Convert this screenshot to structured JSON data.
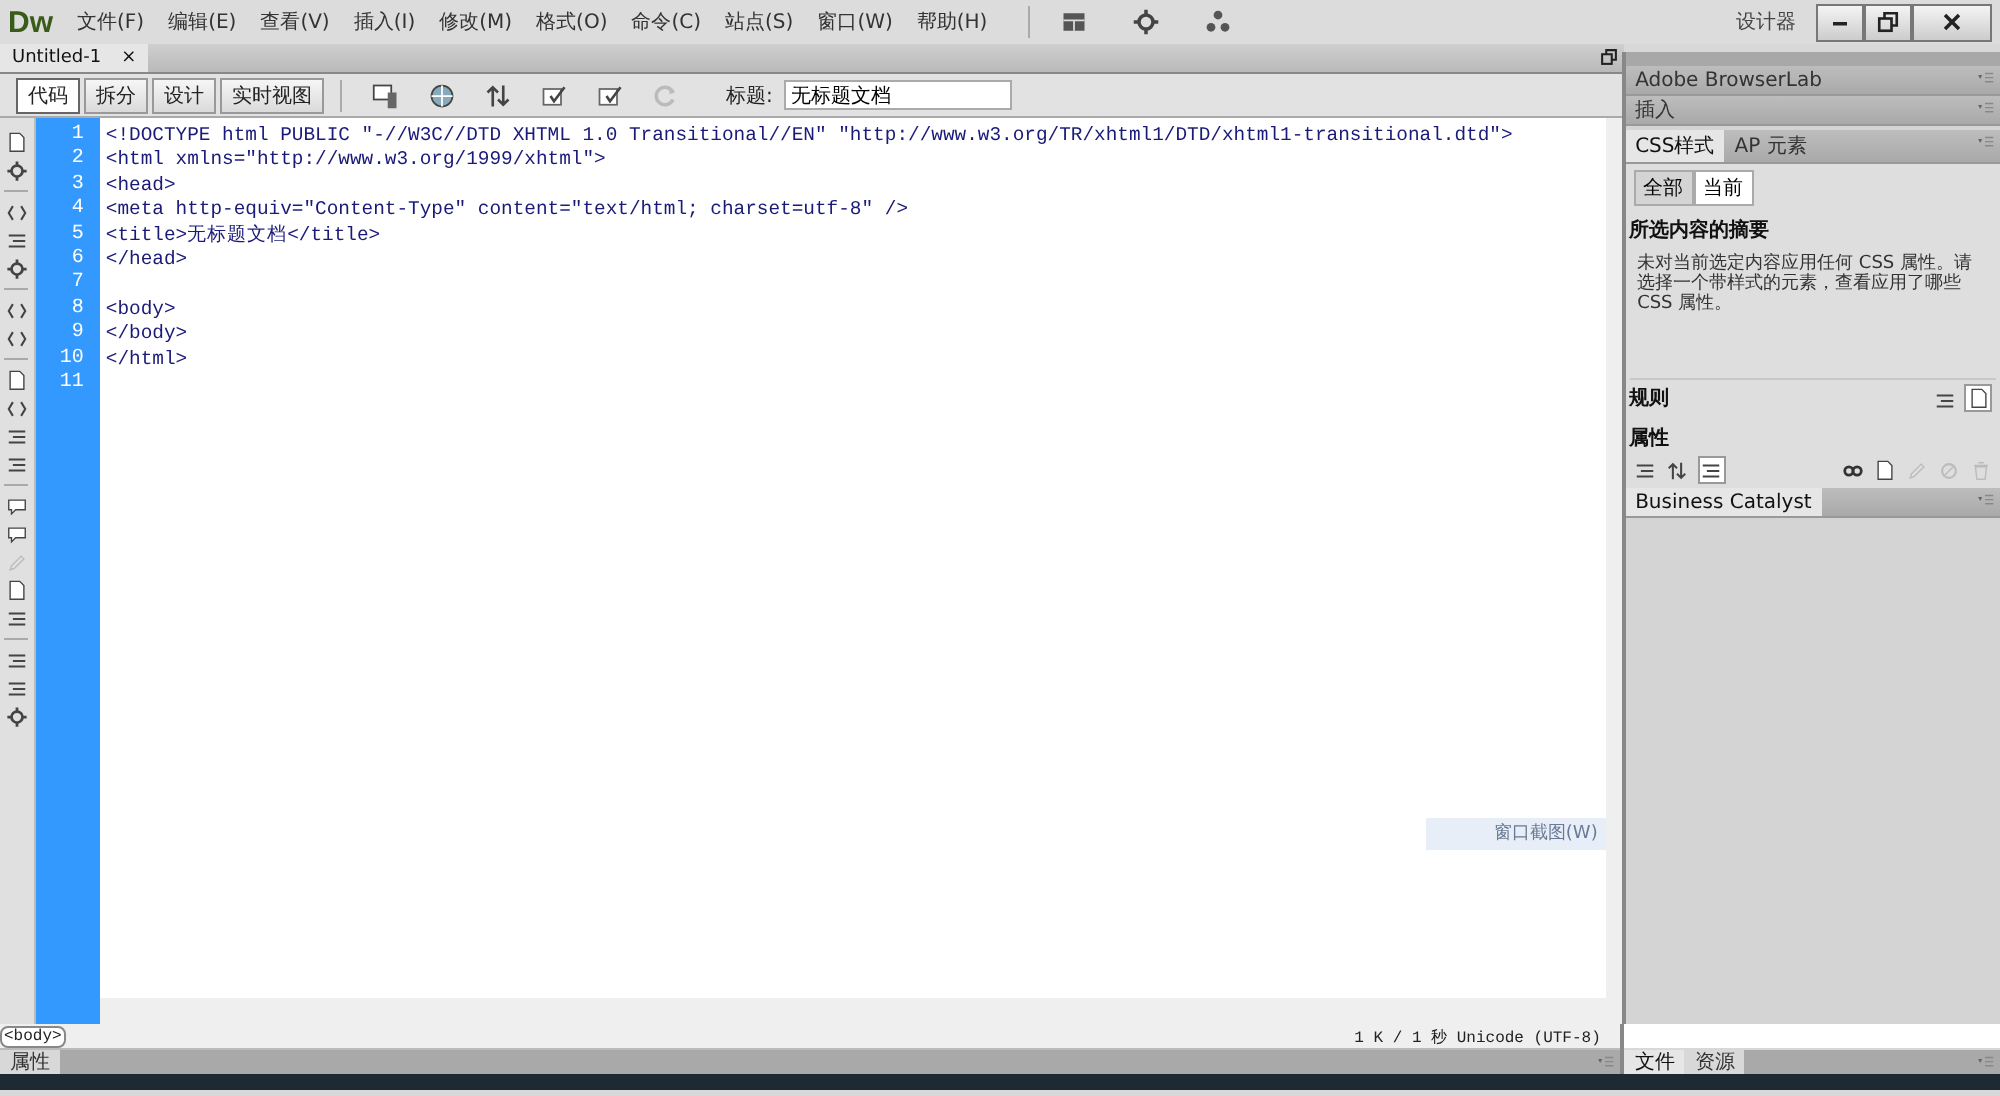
{
  "app": {
    "logo": "Dw",
    "menu": [
      "文件(F)",
      "编辑(E)",
      "查看(V)",
      "插入(I)",
      "修改(M)",
      "格式(O)",
      "命令(C)",
      "站点(S)",
      "窗口(W)",
      "帮助(H)"
    ],
    "workspace": "设计器"
  },
  "document_tabs": [
    {
      "label": "Untitled-1",
      "close": "×",
      "selected": true
    }
  ],
  "view_buttons": [
    {
      "label": "代码",
      "selected": true
    },
    {
      "label": "拆分",
      "selected": false
    },
    {
      "label": "设计",
      "selected": false
    },
    {
      "label": "实时视图",
      "selected": false
    }
  ],
  "title_field": {
    "label": "标题:",
    "value": "无标题文档"
  },
  "code": {
    "lines": [
      {
        "number": "1",
        "text": "<!DOCTYPE html PUBLIC \"-//W3C//DTD XHTML 1.0 Transitional//EN\" \"http://www.w3.org/TR/xhtml1/DTD/xhtml1-transitional.dtd\">"
      },
      {
        "number": "2",
        "text": "<html xmlns=\"http://www.w3.org/1999/xhtml\">"
      },
      {
        "number": "3",
        "text": "<head>"
      },
      {
        "number": "4",
        "text": "<meta http-equiv=\"Content-Type\" content=\"text/html; charset=utf-8\" />"
      },
      {
        "number": "5",
        "text": "<title>无标题文档</title>"
      },
      {
        "number": "6",
        "text": "</head>"
      },
      {
        "number": "7"
      },
      {
        "number": "8",
        "text": "<body>"
      },
      {
        "number": "9",
        "text": "</body>"
      },
      {
        "number": "10",
        "text": "</html>"
      },
      {
        "number": "11"
      }
    ]
  },
  "tooltip": "窗口截图(W)",
  "tag_selector": "<body>",
  "status": "1 K / 1 秒 Unicode (UTF-8)",
  "properties_bar": "属性",
  "right_panel": {
    "headers": [
      {
        "label": "Adobe BrowserLab"
      },
      {
        "label": "插入"
      }
    ],
    "css_tabs": [
      {
        "label": "CSS样式",
        "selected": true
      },
      {
        "label": "AP 元素",
        "selected": false
      }
    ],
    "mode_buttons": [
      {
        "label": "全部",
        "selected": false
      },
      {
        "label": "当前",
        "selected": true
      }
    ],
    "summary_title": "所选内容的摘要",
    "summary_text": "未对当前选定内容应用任何 CSS 属性。请选择一个带样式的元素，查看应用了哪些 CSS 属性。",
    "rules_label": "规则",
    "properties_label": "属性",
    "business_catalyst": "Business Catalyst",
    "bottom_tabs": [
      {
        "label": "文件",
        "selected": true
      },
      {
        "label": "资源",
        "selected": false
      }
    ]
  }
}
